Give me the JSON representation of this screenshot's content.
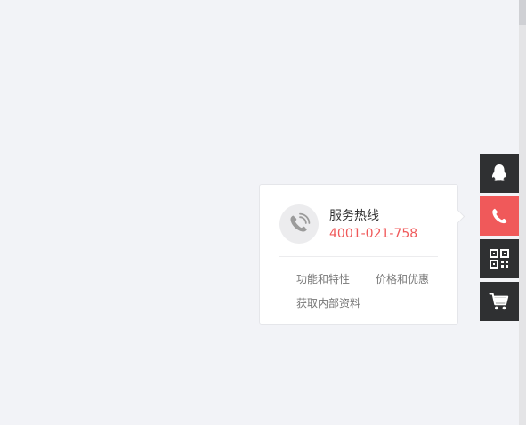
{
  "popup": {
    "hotline_title": "服务热线",
    "hotline_number": "4001-021-758",
    "links": {
      "features": "功能和特性",
      "pricing": "价格和优惠",
      "docs": "获取内部资料"
    }
  },
  "sidebar": {
    "items": [
      {
        "icon": "qq-icon",
        "active": false
      },
      {
        "icon": "phone-icon",
        "active": true
      },
      {
        "icon": "qrcode-icon",
        "active": false
      },
      {
        "icon": "cart-icon",
        "active": false
      }
    ]
  },
  "colors": {
    "page_background": "#f2f3f7",
    "sidebar_background": "#2f3032",
    "accent": "#f0595a",
    "title_text": "#333333",
    "link_text": "#777777"
  }
}
